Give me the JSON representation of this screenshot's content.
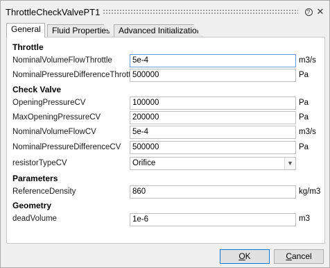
{
  "window": {
    "title": "ThrottleCheckValvePT1"
  },
  "icons": {
    "help": "help-icon",
    "close": "close-icon",
    "grip": "drag-grip"
  },
  "tabs": [
    {
      "label": "General",
      "active": true
    },
    {
      "label": "Fluid Properties",
      "active": false
    },
    {
      "label": "Advanced Initialization",
      "active": false
    }
  ],
  "sections": {
    "throttle": "Throttle",
    "check_valve": "Check Valve",
    "parameters": "Parameters",
    "geometry": "Geometry"
  },
  "fields": {
    "nominal_volume_flow_throttle": {
      "label": "NominalVolumeFlowThrottle",
      "value": "5e-4",
      "unit": "m3/s"
    },
    "nominal_pressure_difference_throttle": {
      "label": "NominalPressureDifferenceThrottle",
      "value": "500000",
      "unit": "Pa"
    },
    "opening_pressure_cv": {
      "label": "OpeningPressureCV",
      "value": "100000",
      "unit": "Pa"
    },
    "max_opening_pressure_cv": {
      "label": "MaxOpeningPressureCV",
      "value": "200000",
      "unit": "Pa"
    },
    "nominal_volume_flow_cv": {
      "label": "NominalVolumeFlowCV",
      "value": "5e-4",
      "unit": "m3/s"
    },
    "nominal_pressure_difference_cv": {
      "label": "NominalPressureDifferenceCV",
      "value": "500000",
      "unit": "Pa"
    },
    "resistor_type_cv": {
      "label": "resistorTypeCV",
      "value": "Orifice"
    },
    "reference_density": {
      "label": "ReferenceDensity",
      "value": "860",
      "unit": "kg/m3"
    },
    "dead_volume": {
      "label": "deadVolume",
      "value": "1e-6",
      "unit": "m3"
    }
  },
  "buttons": {
    "ok": "OK",
    "cancel": "Cancel"
  },
  "colors": {
    "focus_border": "#6a9ad8",
    "default_button_border": "#0078d7"
  }
}
